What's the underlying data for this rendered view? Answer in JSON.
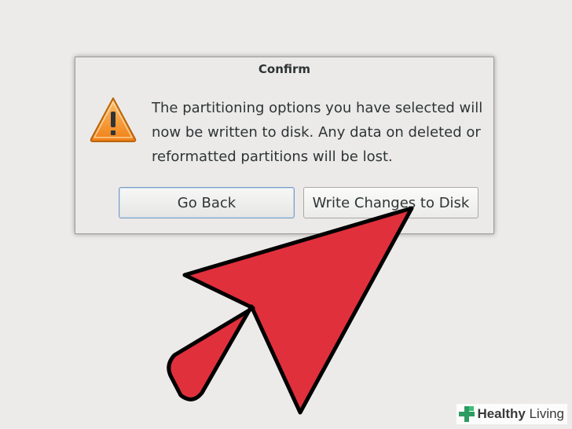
{
  "dialog": {
    "title": "Confirm",
    "message": "The partitioning options you have selected will\nnow be written to disk.  Any data on deleted or\nreformatted partitions will be lost.",
    "icon": "warning-icon",
    "buttons": {
      "back_label": "Go Back",
      "write_label": "Write Changes to Disk"
    }
  },
  "overlay": {
    "arrow_color": "#e0303c",
    "arrow_outline": "#000000"
  },
  "watermark": {
    "text_bold": "Healthy",
    "text_rest": " Living",
    "icon": "plus-cross-icon",
    "icon_color": "#2e9b62"
  }
}
